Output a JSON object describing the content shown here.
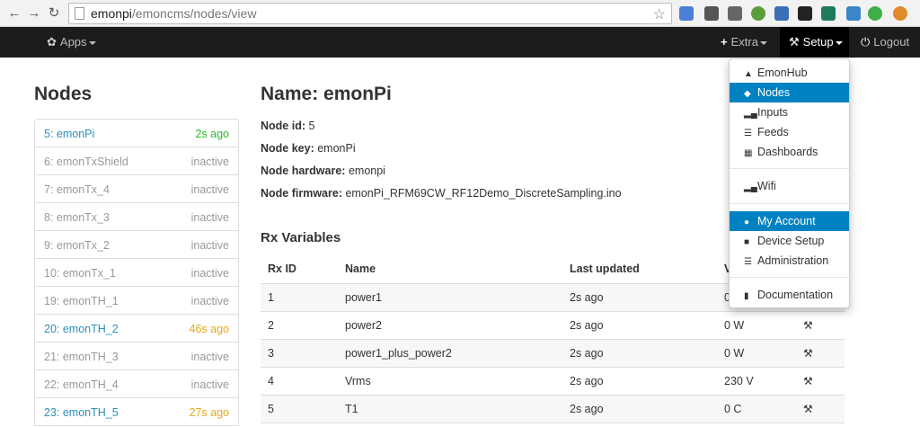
{
  "browser": {
    "url_host": "emonpi",
    "url_path": "/emoncms/nodes/view"
  },
  "navbar": {
    "apps_label": "Apps",
    "extra_label": "Extra",
    "setup_label": "Setup",
    "logout_label": "Logout"
  },
  "sidebar": {
    "title": "Nodes",
    "nodes": [
      {
        "name": "5: emonPi",
        "status": "2s ago"
      },
      {
        "name": "6: emonTxShield",
        "status": "inactive"
      },
      {
        "name": "7: emonTx_4",
        "status": "inactive"
      },
      {
        "name": "8: emonTx_3",
        "status": "inactive"
      },
      {
        "name": "9: emonTx_2",
        "status": "inactive"
      },
      {
        "name": "10: emonTx_1",
        "status": "inactive"
      },
      {
        "name": "19: emonTH_1",
        "status": "inactive"
      },
      {
        "name": "20: emonTH_2",
        "status": "46s ago"
      },
      {
        "name": "21: emonTH_3",
        "status": "inactive"
      },
      {
        "name": "22: emonTH_4",
        "status": "inactive"
      },
      {
        "name": "23: emonTH_5",
        "status": "27s ago"
      }
    ]
  },
  "main": {
    "title": "Name: emonPi",
    "props": [
      {
        "label": "Node id:",
        "value": "5"
      },
      {
        "label": "Node key:",
        "value": "emonPi"
      },
      {
        "label": "Node hardware:",
        "value": "emonpi"
      },
      {
        "label": "Node firmware:",
        "value": "emonPi_RFM69CW_RF12Demo_DiscreteSampling.ino"
      }
    ],
    "rx_title": "Rx Variables",
    "rx_headers": [
      "Rx ID",
      "Name",
      "Last updated",
      "V"
    ],
    "rx_rows": [
      {
        "id": "1",
        "name": "power1",
        "updated": "2s ago",
        "value": "0"
      },
      {
        "id": "2",
        "name": "power2",
        "updated": "2s ago",
        "value": "0 W"
      },
      {
        "id": "3",
        "name": "power1_plus_power2",
        "updated": "2s ago",
        "value": "0 W"
      },
      {
        "id": "4",
        "name": "Vrms",
        "updated": "2s ago",
        "value": "230 V"
      },
      {
        "id": "5",
        "name": "T1",
        "updated": "2s ago",
        "value": "0 C"
      }
    ]
  },
  "setup_menu": {
    "items": [
      {
        "label": "EmonHub"
      },
      {
        "label": "Nodes"
      },
      {
        "label": "Inputs"
      },
      {
        "label": "Feeds"
      },
      {
        "label": "Dashboards"
      },
      {
        "label": "Wifi"
      },
      {
        "label": "My Account"
      },
      {
        "label": "Device Setup"
      },
      {
        "label": "Administration"
      },
      {
        "label": "Documentation"
      }
    ]
  },
  "colors": {
    "navbar_bg": "#1c1c1c",
    "menu_active": "#0081c2",
    "link_blue": "#2a8fbd",
    "status_green": "#2eb82e",
    "status_orange": "#e6a817"
  }
}
